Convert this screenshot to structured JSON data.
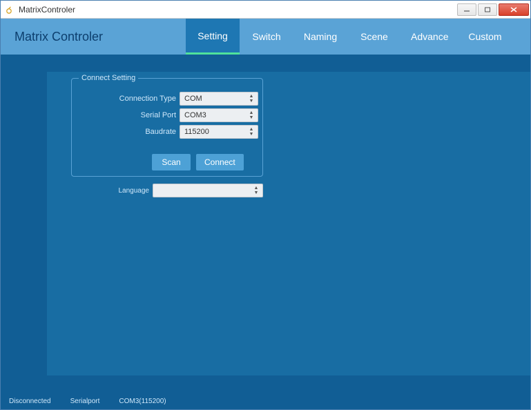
{
  "window": {
    "title": "MatrixControler"
  },
  "header": {
    "app_title": "Matrix Controler",
    "tabs": {
      "setting": "Setting",
      "switch": "Switch",
      "naming": "Naming",
      "scene": "Scene",
      "advance": "Advance",
      "custom": "Custom"
    }
  },
  "connect": {
    "legend": "Connect Setting",
    "conn_type_label": "Connection Type",
    "conn_type_value": "COM",
    "serial_port_label": "Serial Port",
    "serial_port_value": "COM3",
    "baudrate_label": "Baudrate",
    "baudrate_value": "115200",
    "scan_label": "Scan",
    "connect_label": "Connect"
  },
  "language": {
    "label": "Language",
    "value": ""
  },
  "status": {
    "connection": "Disconnected",
    "port_type": "Serialport",
    "port_info": "COM3(115200)"
  }
}
